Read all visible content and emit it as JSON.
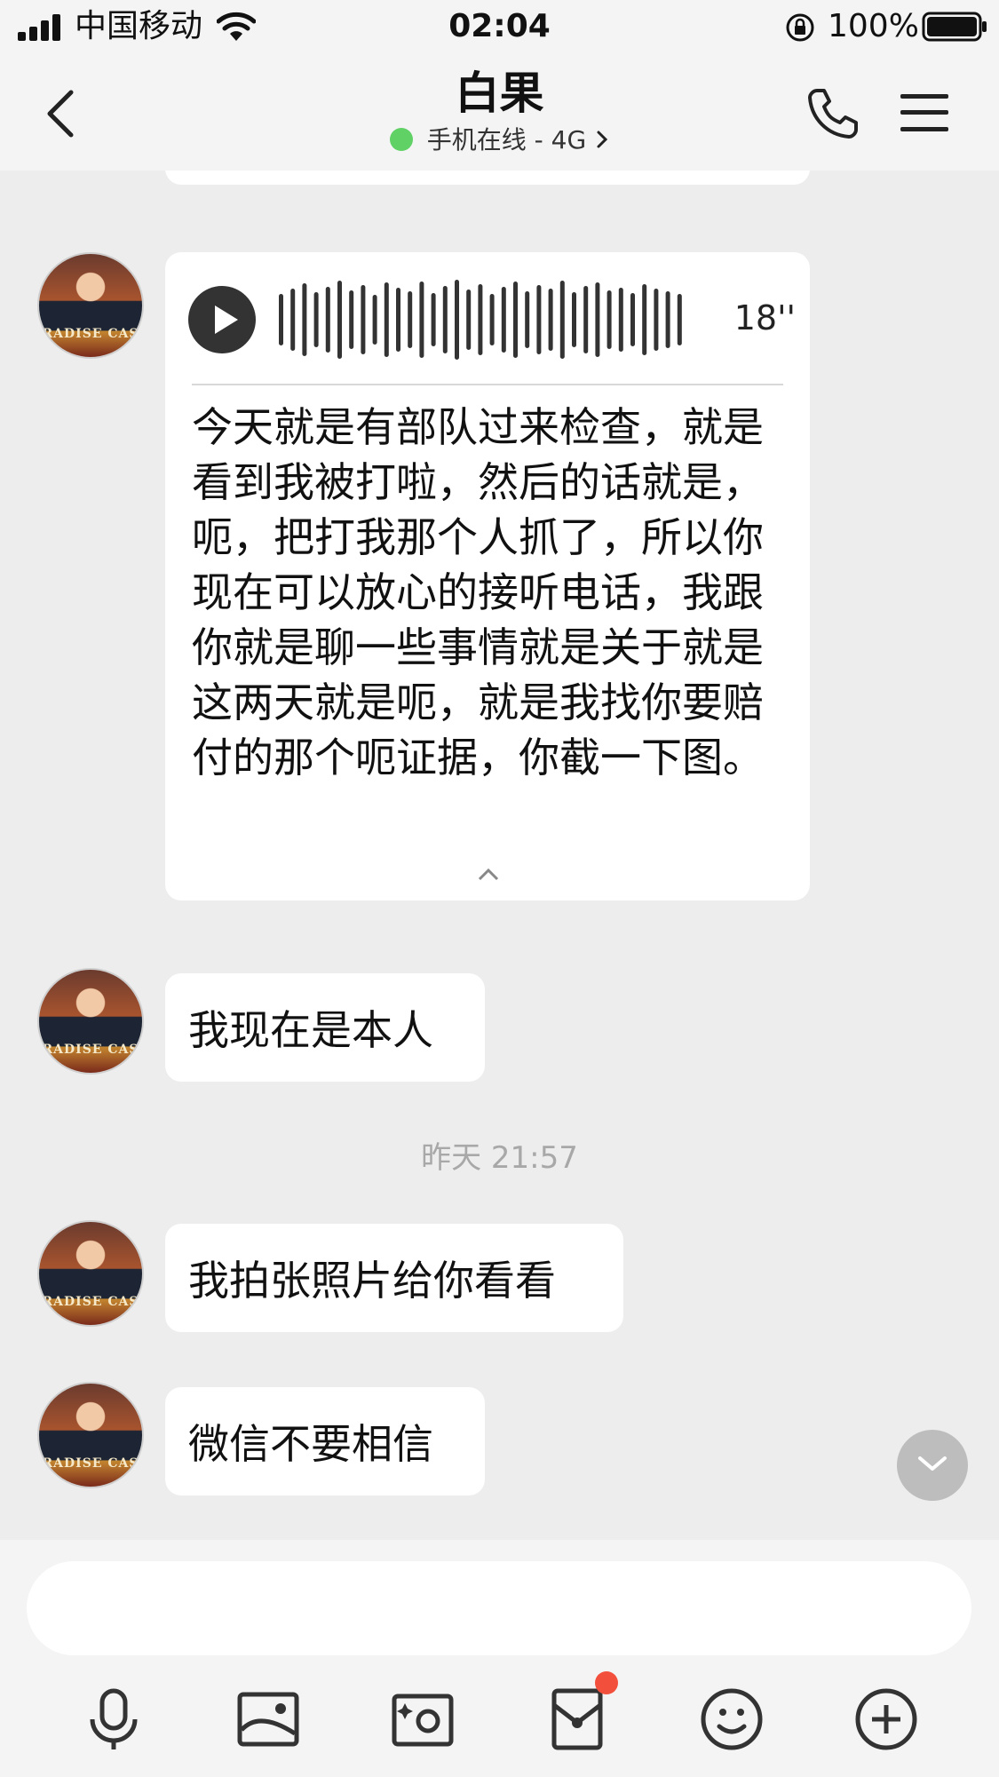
{
  "status_bar": {
    "carrier": "中国移动",
    "time": "02:04",
    "battery": "100%"
  },
  "header": {
    "title": "白果",
    "subtitle": "手机在线 - 4G"
  },
  "avatar": {
    "caption": "RADISE CAS"
  },
  "messages": [
    {
      "type": "voice",
      "duration": "18''",
      "transcript": "今天就是有部队过来检查，就是看到我被打啦，然后的话就是，呃，把打我那个人抓了，所以你现在可以放心的接听电话，我跟你就是聊一些事情就是关于就是这两天就是呃，就是我找你要赔付的那个呃证据，你截一下图。"
    },
    {
      "type": "text",
      "text": "我现在是本人"
    },
    {
      "type": "timestamp",
      "text": "昨天 21:57"
    },
    {
      "type": "text",
      "text": "我拍张照片给你看看"
    },
    {
      "type": "text",
      "text": "微信不要相信"
    }
  ],
  "colors": {
    "background": "#ededed",
    "bubble": "#ffffff",
    "online": "#5fd165",
    "badge": "#f2503c"
  },
  "icons": [
    "signal-icon",
    "wifi-icon",
    "rotation-lock-icon",
    "battery-icon",
    "back-icon",
    "phone-icon",
    "menu-icon",
    "play-icon",
    "chevron-up-icon",
    "scroll-down-icon",
    "microphone-icon",
    "image-icon",
    "camera-icon",
    "red-packet-icon",
    "emoji-icon",
    "plus-icon"
  ]
}
